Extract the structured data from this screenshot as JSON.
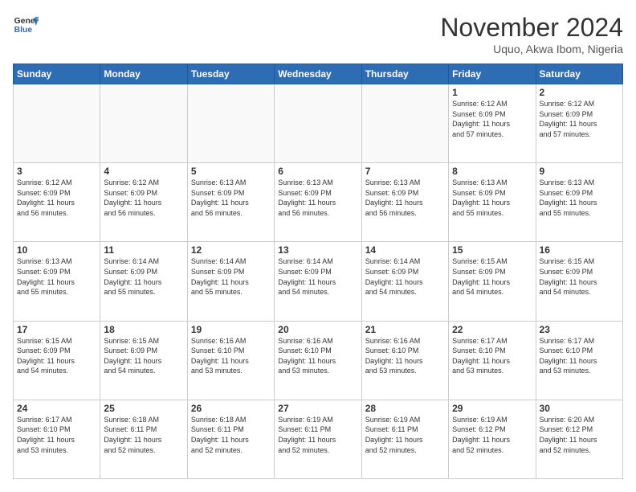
{
  "logo": {
    "line1": "General",
    "line2": "Blue"
  },
  "title": "November 2024",
  "location": "Uquo, Akwa Ibom, Nigeria",
  "days": [
    "Sunday",
    "Monday",
    "Tuesday",
    "Wednesday",
    "Thursday",
    "Friday",
    "Saturday"
  ],
  "weeks": [
    [
      {
        "date": "",
        "info": ""
      },
      {
        "date": "",
        "info": ""
      },
      {
        "date": "",
        "info": ""
      },
      {
        "date": "",
        "info": ""
      },
      {
        "date": "",
        "info": ""
      },
      {
        "date": "1",
        "info": "Sunrise: 6:12 AM\nSunset: 6:09 PM\nDaylight: 11 hours\nand 57 minutes."
      },
      {
        "date": "2",
        "info": "Sunrise: 6:12 AM\nSunset: 6:09 PM\nDaylight: 11 hours\nand 57 minutes."
      }
    ],
    [
      {
        "date": "3",
        "info": "Sunrise: 6:12 AM\nSunset: 6:09 PM\nDaylight: 11 hours\nand 56 minutes."
      },
      {
        "date": "4",
        "info": "Sunrise: 6:12 AM\nSunset: 6:09 PM\nDaylight: 11 hours\nand 56 minutes."
      },
      {
        "date": "5",
        "info": "Sunrise: 6:13 AM\nSunset: 6:09 PM\nDaylight: 11 hours\nand 56 minutes."
      },
      {
        "date": "6",
        "info": "Sunrise: 6:13 AM\nSunset: 6:09 PM\nDaylight: 11 hours\nand 56 minutes."
      },
      {
        "date": "7",
        "info": "Sunrise: 6:13 AM\nSunset: 6:09 PM\nDaylight: 11 hours\nand 56 minutes."
      },
      {
        "date": "8",
        "info": "Sunrise: 6:13 AM\nSunset: 6:09 PM\nDaylight: 11 hours\nand 55 minutes."
      },
      {
        "date": "9",
        "info": "Sunrise: 6:13 AM\nSunset: 6:09 PM\nDaylight: 11 hours\nand 55 minutes."
      }
    ],
    [
      {
        "date": "10",
        "info": "Sunrise: 6:13 AM\nSunset: 6:09 PM\nDaylight: 11 hours\nand 55 minutes."
      },
      {
        "date": "11",
        "info": "Sunrise: 6:14 AM\nSunset: 6:09 PM\nDaylight: 11 hours\nand 55 minutes."
      },
      {
        "date": "12",
        "info": "Sunrise: 6:14 AM\nSunset: 6:09 PM\nDaylight: 11 hours\nand 55 minutes."
      },
      {
        "date": "13",
        "info": "Sunrise: 6:14 AM\nSunset: 6:09 PM\nDaylight: 11 hours\nand 54 minutes."
      },
      {
        "date": "14",
        "info": "Sunrise: 6:14 AM\nSunset: 6:09 PM\nDaylight: 11 hours\nand 54 minutes."
      },
      {
        "date": "15",
        "info": "Sunrise: 6:15 AM\nSunset: 6:09 PM\nDaylight: 11 hours\nand 54 minutes."
      },
      {
        "date": "16",
        "info": "Sunrise: 6:15 AM\nSunset: 6:09 PM\nDaylight: 11 hours\nand 54 minutes."
      }
    ],
    [
      {
        "date": "17",
        "info": "Sunrise: 6:15 AM\nSunset: 6:09 PM\nDaylight: 11 hours\nand 54 minutes."
      },
      {
        "date": "18",
        "info": "Sunrise: 6:15 AM\nSunset: 6:09 PM\nDaylight: 11 hours\nand 54 minutes."
      },
      {
        "date": "19",
        "info": "Sunrise: 6:16 AM\nSunset: 6:10 PM\nDaylight: 11 hours\nand 53 minutes."
      },
      {
        "date": "20",
        "info": "Sunrise: 6:16 AM\nSunset: 6:10 PM\nDaylight: 11 hours\nand 53 minutes."
      },
      {
        "date": "21",
        "info": "Sunrise: 6:16 AM\nSunset: 6:10 PM\nDaylight: 11 hours\nand 53 minutes."
      },
      {
        "date": "22",
        "info": "Sunrise: 6:17 AM\nSunset: 6:10 PM\nDaylight: 11 hours\nand 53 minutes."
      },
      {
        "date": "23",
        "info": "Sunrise: 6:17 AM\nSunset: 6:10 PM\nDaylight: 11 hours\nand 53 minutes."
      }
    ],
    [
      {
        "date": "24",
        "info": "Sunrise: 6:17 AM\nSunset: 6:10 PM\nDaylight: 11 hours\nand 53 minutes."
      },
      {
        "date": "25",
        "info": "Sunrise: 6:18 AM\nSunset: 6:11 PM\nDaylight: 11 hours\nand 52 minutes."
      },
      {
        "date": "26",
        "info": "Sunrise: 6:18 AM\nSunset: 6:11 PM\nDaylight: 11 hours\nand 52 minutes."
      },
      {
        "date": "27",
        "info": "Sunrise: 6:19 AM\nSunset: 6:11 PM\nDaylight: 11 hours\nand 52 minutes."
      },
      {
        "date": "28",
        "info": "Sunrise: 6:19 AM\nSunset: 6:11 PM\nDaylight: 11 hours\nand 52 minutes."
      },
      {
        "date": "29",
        "info": "Sunrise: 6:19 AM\nSunset: 6:12 PM\nDaylight: 11 hours\nand 52 minutes."
      },
      {
        "date": "30",
        "info": "Sunrise: 6:20 AM\nSunset: 6:12 PM\nDaylight: 11 hours\nand 52 minutes."
      }
    ]
  ]
}
